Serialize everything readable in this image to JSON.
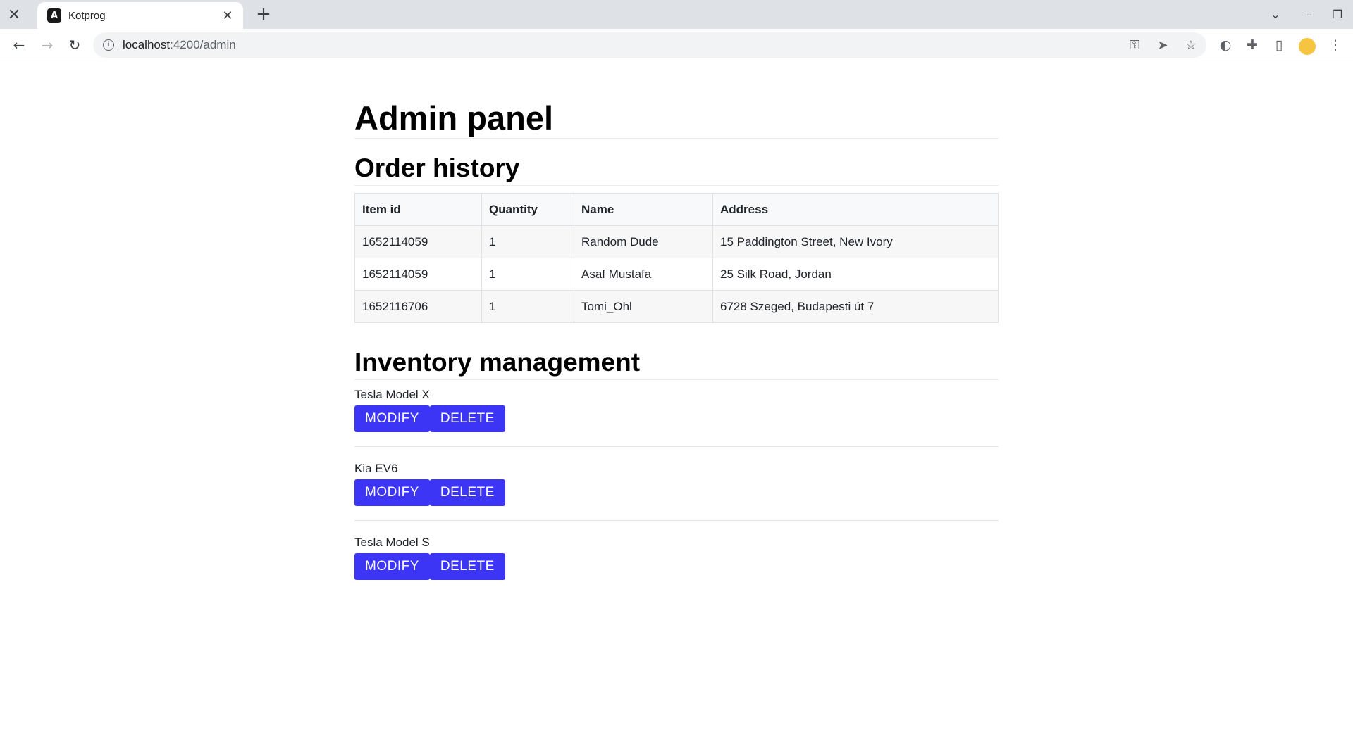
{
  "browser": {
    "tab_title": "Kotprog",
    "url_host": "localhost",
    "url_path": ":4200/admin",
    "favicon_letter": "A"
  },
  "page": {
    "title": "Admin panel",
    "order_history": {
      "heading": "Order history",
      "columns": [
        "Item id",
        "Quantity",
        "Name",
        "Address"
      ],
      "rows": [
        [
          "1652114059",
          "1",
          "Random Dude",
          "15 Paddington Street, New Ivory"
        ],
        [
          "1652114059",
          "1",
          "Asaf Mustafa",
          "25 Silk Road, Jordan"
        ],
        [
          "1652116706",
          "1",
          "Tomi_Ohl",
          "6728 Szeged, Budapesti út 7"
        ]
      ]
    },
    "inventory": {
      "heading": "Inventory management",
      "modify_label": "MODIFY",
      "delete_label": "DELETE",
      "items": [
        {
          "name": "Tesla Model X"
        },
        {
          "name": "Kia EV6"
        },
        {
          "name": "Tesla Model S"
        }
      ]
    }
  },
  "colors": {
    "button": "#3d35f5",
    "tabstrip": "#dee1e6"
  }
}
